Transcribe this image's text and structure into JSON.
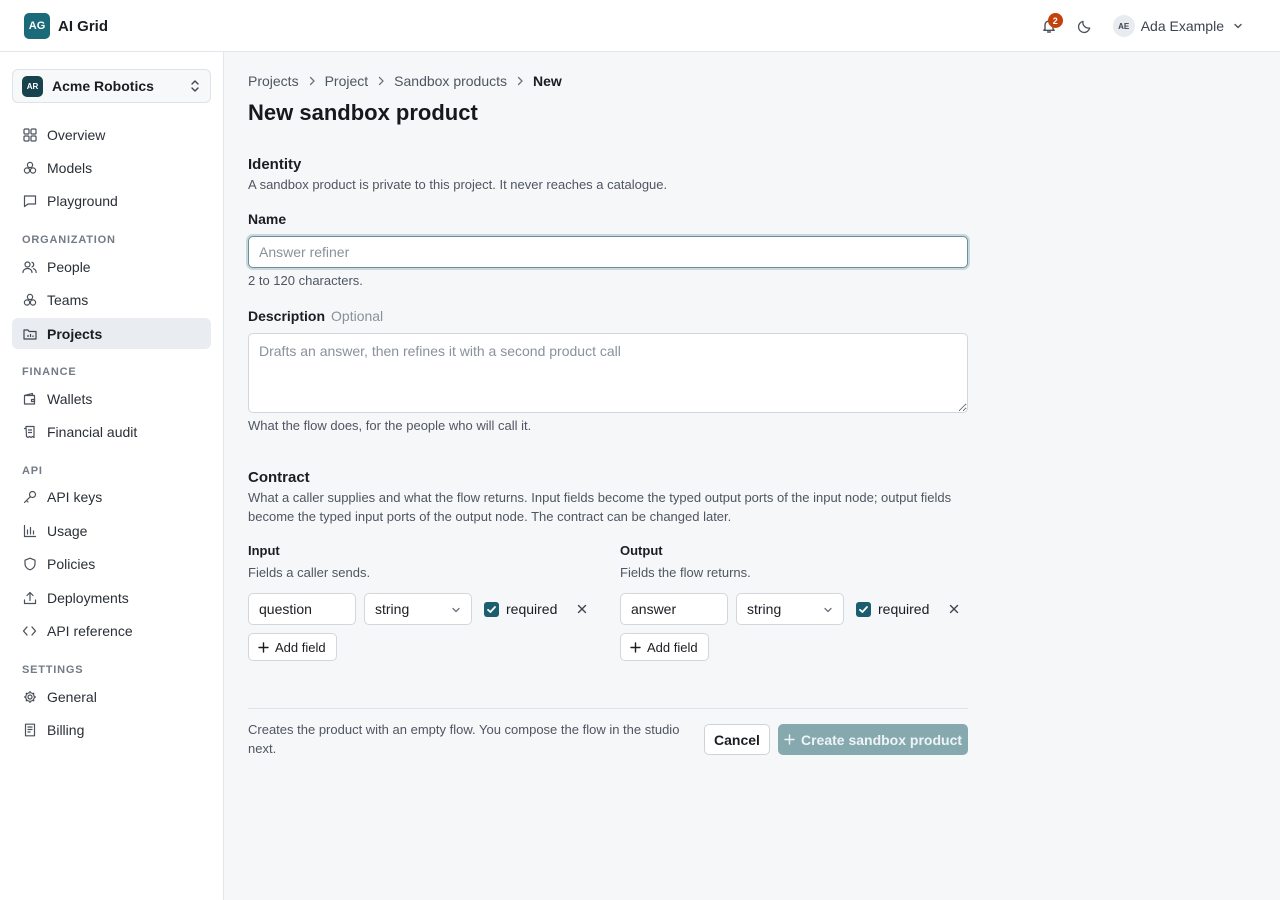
{
  "app": {
    "logo_initials": "AG",
    "name": "AI Grid",
    "notifications_count": "2",
    "user_initials": "AE",
    "user_name": "Ada Example"
  },
  "org": {
    "initials": "AR",
    "name": "Acme Robotics"
  },
  "sidebar": {
    "main_items": [
      {
        "label": "Overview",
        "icon": "grid-icon"
      },
      {
        "label": "Models",
        "icon": "cubes-icon"
      },
      {
        "label": "Playground",
        "icon": "chat-icon"
      }
    ],
    "organization_header": "ORGANIZATION",
    "organization_items": [
      {
        "label": "People",
        "icon": "people-icon"
      },
      {
        "label": "Teams",
        "icon": "cubes-icon"
      },
      {
        "label": "Projects",
        "icon": "folder-chart-icon",
        "active": true
      }
    ],
    "finance_header": "FINANCE",
    "finance_items": [
      {
        "label": "Wallets",
        "icon": "wallet-icon"
      },
      {
        "label": "Financial audit",
        "icon": "receipt-icon"
      }
    ],
    "api_header": "API",
    "api_items": [
      {
        "label": "API keys",
        "icon": "key-icon"
      },
      {
        "label": "Usage",
        "icon": "bar-chart-icon"
      },
      {
        "label": "Policies",
        "icon": "shield-icon"
      },
      {
        "label": "Deployments",
        "icon": "upload-icon"
      },
      {
        "label": "API reference",
        "icon": "code-icon"
      }
    ],
    "settings_header": "SETTINGS",
    "settings_items": [
      {
        "label": "General",
        "icon": "gear-icon"
      },
      {
        "label": "Billing",
        "icon": "document-icon"
      }
    ]
  },
  "breadcrumb": [
    "Projects",
    "Project",
    "Sandbox products",
    "New"
  ],
  "page_title": "New sandbox product",
  "identity": {
    "title": "Identity",
    "description": "A sandbox product is private to this project. It never reaches a catalogue.",
    "name_label": "Name",
    "name_placeholder": "Answer refiner",
    "name_value": "",
    "name_hint": "2 to 120 characters.",
    "description_label": "Description",
    "description_optional": "Optional",
    "description_placeholder": "Drafts an answer, then refines it with a second product call",
    "description_hint": "What the flow does, for the people who will call it."
  },
  "contract": {
    "title": "Contract",
    "description": "What a caller supplies and what the flow returns. Input fields become the typed output ports of the input node; output fields become the typed input ports of the output node. The contract can be changed later.",
    "input": {
      "title": "Input",
      "description": "Fields a caller sends.",
      "fields": [
        {
          "name": "question",
          "type": "string",
          "required": true,
          "required_label": "required"
        }
      ],
      "add_label": "Add field"
    },
    "output": {
      "title": "Output",
      "description": "Fields the flow returns.",
      "fields": [
        {
          "name": "answer",
          "type": "string",
          "required": true,
          "required_label": "required"
        }
      ],
      "add_label": "Add field"
    }
  },
  "footer": {
    "note": "Creates the product with an empty flow. You compose the flow in the studio next.",
    "cancel_label": "Cancel",
    "create_label": "Create sandbox product"
  },
  "colors": {
    "brand": "#1b6a7a",
    "badge": "#c2410c",
    "primary_disabled": "#86a9b0",
    "checkbox": "#1b5e6d"
  }
}
